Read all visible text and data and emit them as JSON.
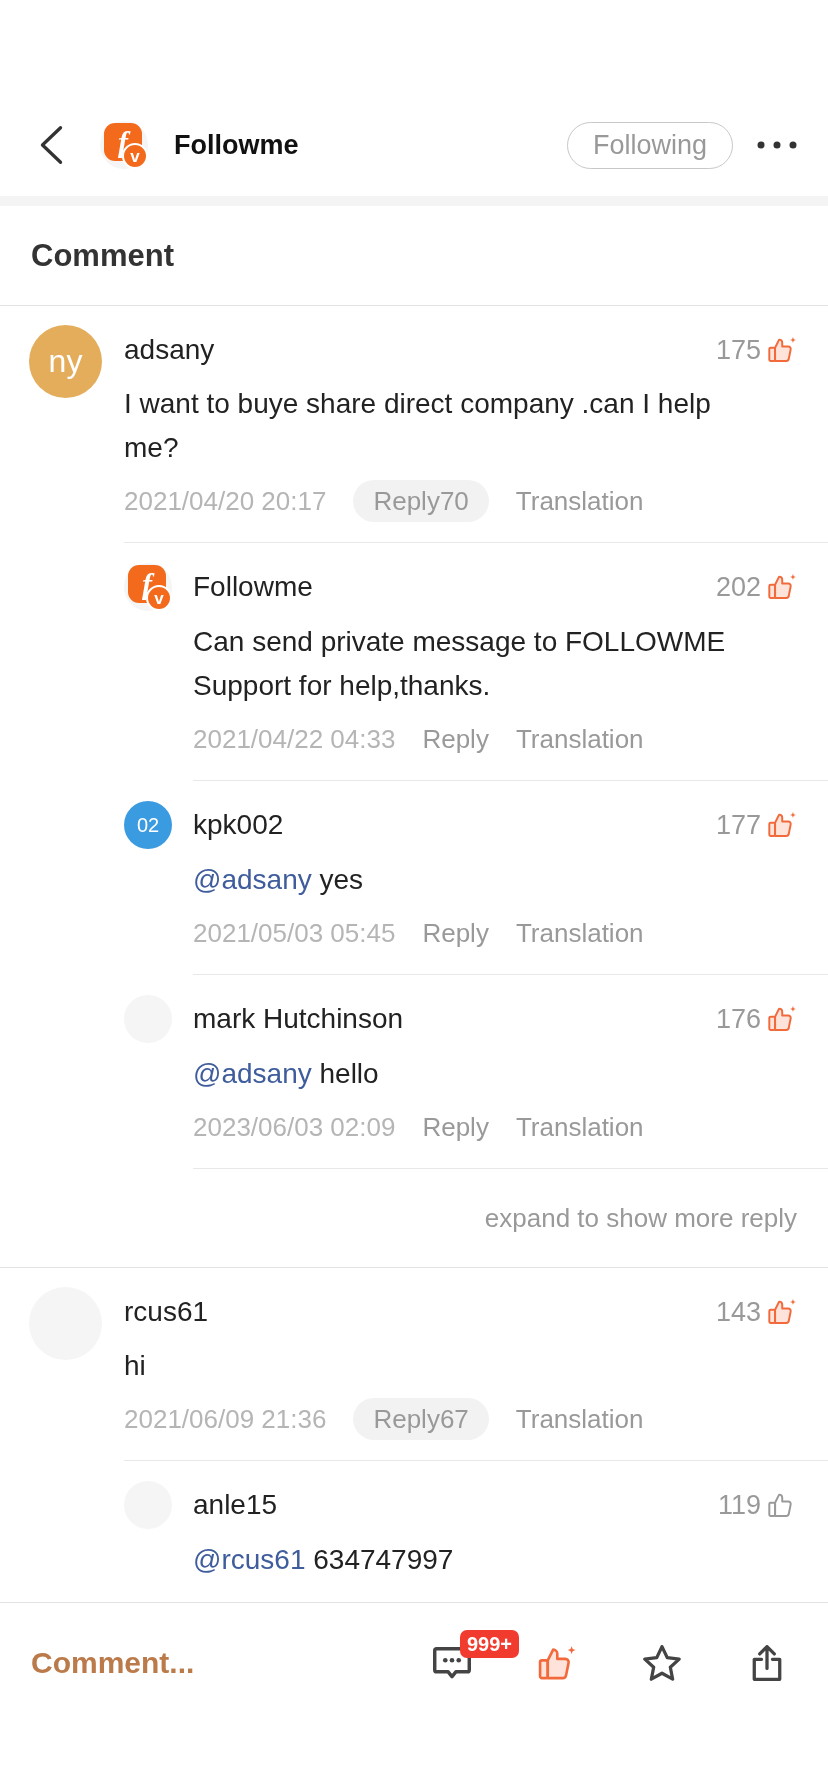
{
  "header": {
    "logo": {
      "mark": "f",
      "badge": "v"
    },
    "title": "Followme",
    "follow_button": {
      "label": "Following",
      "following": true
    }
  },
  "section_title": "Comment",
  "comments": [
    {
      "author": "adsany",
      "avatar": {
        "kind": "initials",
        "text": "ny",
        "color": "#e4ad5c"
      },
      "likes": "175",
      "liked": true,
      "body": {
        "text": "I want to buye share direct company .can I help me?"
      },
      "time": "2021/04/20 20:17",
      "reply_label": "Reply70",
      "translate_label": "Translation",
      "replies": [
        {
          "author": "Followme",
          "avatar": {
            "kind": "logo",
            "mark": "f",
            "badge": "v"
          },
          "likes": "202",
          "liked": true,
          "body": {
            "text": "Can send private message to FOLLOWME Support for help,thanks."
          },
          "time": "2021/04/22 04:33",
          "reply_label": "Reply",
          "translate_label": "Translation"
        },
        {
          "author": "kpk002",
          "avatar": {
            "kind": "initials",
            "text": "02",
            "color": "#3b9be0"
          },
          "likes": "177",
          "liked": true,
          "body": {
            "mention": "@adsany",
            "text": "yes"
          },
          "time": "2021/05/03 05:45",
          "reply_label": "Reply",
          "translate_label": "Translation"
        },
        {
          "author": "mark Hutchinson",
          "avatar": {
            "kind": "blank"
          },
          "likes": "176",
          "liked": true,
          "body": {
            "mention": "@adsany",
            "text": "hello"
          },
          "time": "2023/06/03 02:09",
          "reply_label": "Reply",
          "translate_label": "Translation"
        }
      ],
      "more_label": "expand to show more reply"
    },
    {
      "author": "rcus61",
      "avatar": {
        "kind": "blank"
      },
      "likes": "143",
      "liked": true,
      "body": {
        "text": "hi"
      },
      "time": "2021/06/09 21:36",
      "reply_label": "Reply67",
      "translate_label": "Translation",
      "replies": [
        {
          "author": "anle15",
          "avatar": {
            "kind": "blank"
          },
          "likes": "119",
          "liked": false,
          "body": {
            "mention": "@rcus61",
            "text": "634747997"
          }
        }
      ]
    }
  ],
  "bottom_bar": {
    "placeholder": "Comment...",
    "comment_badge": "999+",
    "liked": true,
    "starred": false
  }
}
